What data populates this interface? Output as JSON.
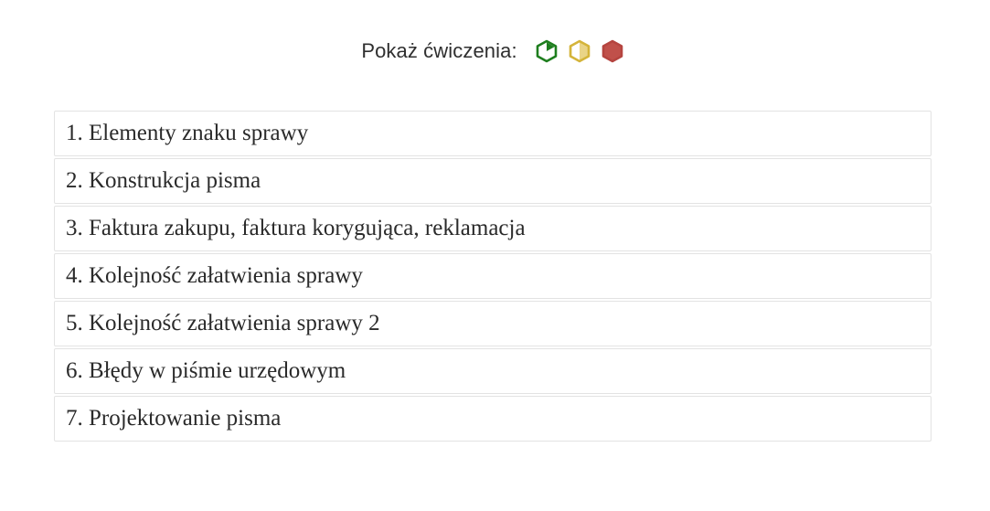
{
  "filter": {
    "label": "Pokaż ćwiczenia:",
    "icons": [
      {
        "name": "easy-level-icon",
        "color": "#1e7e1e"
      },
      {
        "name": "medium-level-icon",
        "color": "#d4b43a"
      },
      {
        "name": "hard-level-icon",
        "color": "#b5443f"
      }
    ]
  },
  "exercises": [
    {
      "label": "1. Elementy znaku sprawy"
    },
    {
      "label": "2. Konstrukcja pisma"
    },
    {
      "label": "3. Faktura zakupu, faktura korygująca, reklamacja"
    },
    {
      "label": "4. Kolejność załatwienia sprawy"
    },
    {
      "label": "5. Kolejność załatwienia sprawy 2"
    },
    {
      "label": "6. Błędy w piśmie urzędowym"
    },
    {
      "label": "7. Projektowanie pisma"
    }
  ]
}
